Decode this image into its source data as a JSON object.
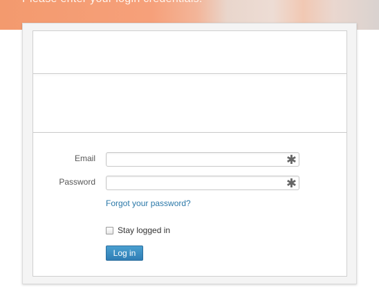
{
  "banner": {
    "text": "Please enter your login credentials."
  },
  "login_form": {
    "email_label": "Email",
    "email_value": "",
    "password_label": "Password",
    "password_value": "",
    "required_marker": "✱",
    "forgot_link": "Forgot your password?",
    "stay_logged_in_label": "Stay logged in",
    "stay_logged_in_checked": false,
    "login_button": "Log in"
  },
  "colors": {
    "link": "#2a78a8",
    "button": "#3a8dc3",
    "banner_orange": "#f39a6e"
  }
}
